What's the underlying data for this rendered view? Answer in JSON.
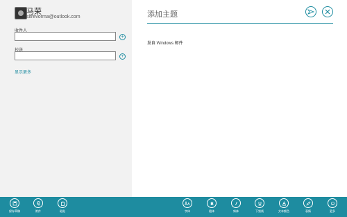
{
  "sender": {
    "name": "马荣",
    "email": "sltrevorma@outlook.com"
  },
  "fields": {
    "to_label": "收件人",
    "cc_label": "抄送",
    "show_more": "显示更多"
  },
  "compose": {
    "subject_placeholder": "添加主题",
    "body_text": "发自 Windows 邮件"
  },
  "appbar": {
    "save_draft": "保存草稿",
    "attach": "附件",
    "paste": "粘贴",
    "font": "字体",
    "bold": "粗体",
    "italic": "斜体",
    "underline": "下划线",
    "text_color": "文本颜色",
    "emoji": "表情",
    "more": "更多"
  },
  "colors": {
    "accent": "#1e8ca0",
    "left_pane_bg": "#f2f2f2"
  }
}
